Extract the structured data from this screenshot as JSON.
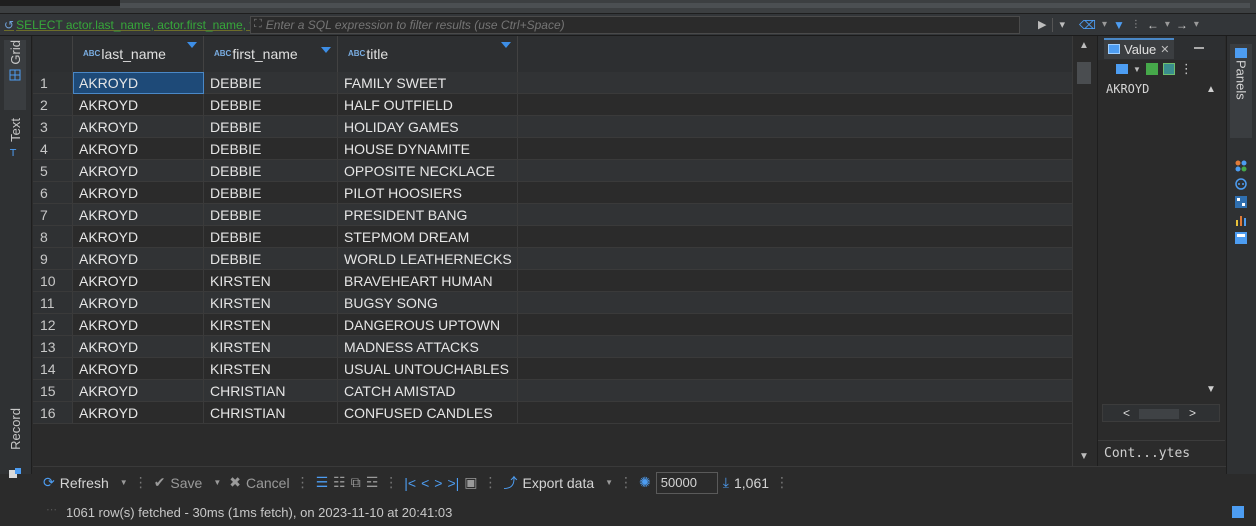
{
  "filter": {
    "sql_text": "SELECT actor.last_name, actor.first_name, f",
    "placeholder": "Enter a SQL expression to filter results (use Ctrl+Space)"
  },
  "left_tabs": [
    "Grid",
    "Text",
    "Record"
  ],
  "columns": [
    {
      "type": "ABC",
      "name": "last_name"
    },
    {
      "type": "ABC",
      "name": "first_name"
    },
    {
      "type": "ABC",
      "name": "title"
    }
  ],
  "rows": [
    {
      "n": "1",
      "last_name": "AKROYD",
      "first_name": "DEBBIE",
      "title": "FAMILY SWEET"
    },
    {
      "n": "2",
      "last_name": "AKROYD",
      "first_name": "DEBBIE",
      "title": "HALF OUTFIELD"
    },
    {
      "n": "3",
      "last_name": "AKROYD",
      "first_name": "DEBBIE",
      "title": "HOLIDAY GAMES"
    },
    {
      "n": "4",
      "last_name": "AKROYD",
      "first_name": "DEBBIE",
      "title": "HOUSE DYNAMITE"
    },
    {
      "n": "5",
      "last_name": "AKROYD",
      "first_name": "DEBBIE",
      "title": "OPPOSITE NECKLACE"
    },
    {
      "n": "6",
      "last_name": "AKROYD",
      "first_name": "DEBBIE",
      "title": "PILOT HOOSIERS"
    },
    {
      "n": "7",
      "last_name": "AKROYD",
      "first_name": "DEBBIE",
      "title": "PRESIDENT BANG"
    },
    {
      "n": "8",
      "last_name": "AKROYD",
      "first_name": "DEBBIE",
      "title": "STEPMOM DREAM"
    },
    {
      "n": "9",
      "last_name": "AKROYD",
      "first_name": "DEBBIE",
      "title": "WORLD LEATHERNECKS"
    },
    {
      "n": "10",
      "last_name": "AKROYD",
      "first_name": "KIRSTEN",
      "title": "BRAVEHEART HUMAN"
    },
    {
      "n": "11",
      "last_name": "AKROYD",
      "first_name": "KIRSTEN",
      "title": "BUGSY SONG"
    },
    {
      "n": "12",
      "last_name": "AKROYD",
      "first_name": "KIRSTEN",
      "title": "DANGEROUS UPTOWN"
    },
    {
      "n": "13",
      "last_name": "AKROYD",
      "first_name": "KIRSTEN",
      "title": "MADNESS ATTACKS"
    },
    {
      "n": "14",
      "last_name": "AKROYD",
      "first_name": "KIRSTEN",
      "title": "USUAL UNTOUCHABLES"
    },
    {
      "n": "15",
      "last_name": "AKROYD",
      "first_name": "CHRISTIAN",
      "title": "CATCH AMISTAD"
    },
    {
      "n": "16",
      "last_name": "AKROYD",
      "first_name": "CHRISTIAN",
      "title": "CONFUSED CANDLES"
    }
  ],
  "value_panel": {
    "tab_label": "Value",
    "value": "AKROYD",
    "content_label": "Cont...ytes"
  },
  "panels_label": "Panels",
  "toolbar": {
    "refresh": "Refresh",
    "save": "Save",
    "cancel": "Cancel",
    "export": "Export data",
    "fetch_size": "50000",
    "row_count": "1,061"
  },
  "status": "1061 row(s) fetched - 30ms (1ms fetch), on 2023-11-10 at 20:41:03",
  "colors": {
    "accent": "#4d9df2",
    "selection": "#1e4a78",
    "sql_green": "#37a83a"
  }
}
